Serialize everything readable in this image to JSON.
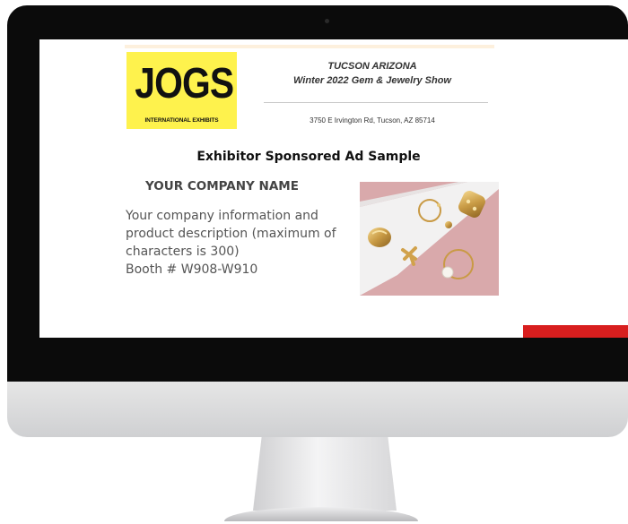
{
  "ad": {
    "logo_main": "JOGS",
    "logo_sub": "INTERNATIONAL EXHIBITS",
    "show_city": "TUCSON ARIZONA",
    "show_name": "Winter 2022 Gem & Jewelry Show",
    "address": "3750 E Irvington Rd, Tucson, AZ 85714",
    "title": "Exhibitor Sponsored Ad Sample",
    "company_name": "YOUR COMPANY NAME",
    "description": "Your company information and product description (maximum of characters is 300)",
    "booth": "Booth # W908-W910"
  },
  "colors": {
    "logo_bg": "#fef24d",
    "accent_red": "#d81e1e",
    "photo_bg": "#d5a3a5"
  }
}
